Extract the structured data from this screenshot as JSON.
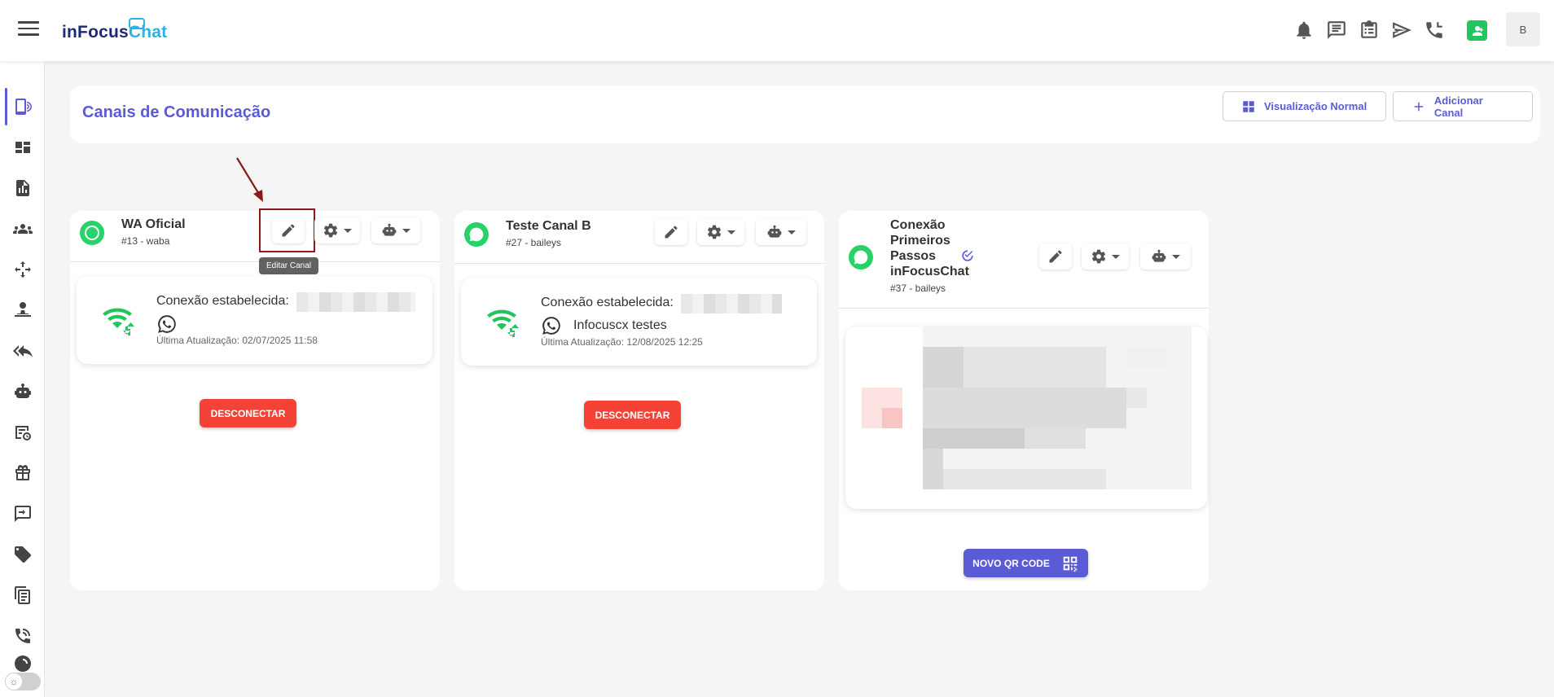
{
  "app": {
    "logo_part1": "inFocus",
    "logo_part2": "Chat",
    "avatar_initial": "B"
  },
  "topbar_icons": [
    "bell-icon",
    "chat-icon",
    "clipboard-icon",
    "send-icon",
    "phone-icon",
    "contact-icon"
  ],
  "sidebar": [
    "channels-icon",
    "dashboard-icon",
    "reports-icon",
    "contacts-icon",
    "flows-icon",
    "attendants-icon",
    "quick-replies-icon",
    "bot-icon",
    "schedule-icon",
    "gift-icon",
    "transfer-icon",
    "tags-icon",
    "clipboard-icon",
    "phone-icon",
    "more-icon"
  ],
  "header": {
    "title": "Canais de Comunicação",
    "view_button": "Visualização Normal",
    "add_button": "Adicionar Canal"
  },
  "channels": [
    {
      "name": "WA Oficial",
      "sub": "#13 - waba",
      "tooltip": "Editar Canal",
      "status_label": "Conexão estabelecida:",
      "phone_name": "",
      "last_update": "Última Atualização: 02/07/2025 11:58",
      "action": "DESCONECTAR"
    },
    {
      "name": "Teste Canal B",
      "sub": "#27 - baileys",
      "status_label": "Conexão estabelecida:",
      "phone_name": "Infocuscx testes",
      "last_update": "Última Atualização: 12/08/2025 12:25",
      "action": "DESCONECTAR"
    },
    {
      "name_lines": [
        "Conexão",
        "Primeiros",
        "Passos",
        "inFocusChat"
      ],
      "sub": "#37 - baileys",
      "action": "NOVO QR CODE"
    }
  ],
  "colors": {
    "accent": "#5b5bd6",
    "whatsapp": "#25d366",
    "danger": "#f44336",
    "highlight": "#8b1a1a"
  }
}
